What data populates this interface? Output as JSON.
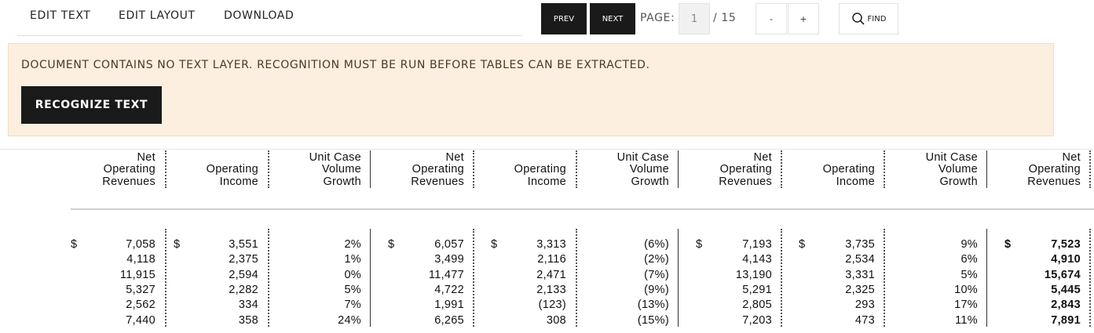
{
  "toolbar": {
    "menu": [
      "EDIT TEXT",
      "EDIT LAYOUT",
      "DOWNLOAD"
    ],
    "prev_label": "PREV",
    "next_label": "NEXT",
    "page_label": "PAGE:",
    "page_value": "1",
    "page_total": "/ 15",
    "zoom_out_label": "-",
    "zoom_in_label": "+",
    "find_label": "FIND",
    "find_icon": "search-icon"
  },
  "banner": {
    "message": "DOCUMENT CONTAINS NO TEXT LAYER. RECOGNITION MUST BE RUN BEFORE TABLES CAN BE EXTRACTED.",
    "button_label": "RECOGNIZE TEXT",
    "background": "#fcefdf"
  },
  "table": {
    "headers": [
      [
        "Net",
        "Operating",
        "Revenues"
      ],
      [
        "Operating",
        "Income"
      ],
      [
        "Unit Case",
        "Volume",
        "Growth"
      ],
      [
        "Net",
        "Operating",
        "Revenues"
      ],
      [
        "Operating",
        "Income"
      ],
      [
        "Unit Case",
        "Volume",
        "Growth"
      ],
      [
        "Net",
        "Operating",
        "Revenues"
      ],
      [
        "Operating",
        "Income"
      ],
      [
        "Unit Case",
        "Volume",
        "Growth"
      ],
      [
        "Net",
        "Operating",
        "Revenues"
      ]
    ],
    "currency_symbol": "$",
    "rows": [
      [
        "7,058",
        "3,551",
        "2%",
        "6,057",
        "3,313",
        "(6%)",
        "7,193",
        "3,735",
        "9%",
        "7,523"
      ],
      [
        "4,118",
        "2,375",
        "1%",
        "3,499",
        "2,116",
        "(2%)",
        "4,143",
        "2,534",
        "6%",
        "4,910"
      ],
      [
        "11,915",
        "2,594",
        "0%",
        "11,477",
        "2,471",
        "(7%)",
        "13,190",
        "3,331",
        "5%",
        "15,674"
      ],
      [
        "5,327",
        "2,282",
        "5%",
        "4,722",
        "2,133",
        "(9%)",
        "5,291",
        "2,325",
        "10%",
        "5,445"
      ],
      [
        "2,562",
        "334",
        "7%",
        "1,991",
        "(123)",
        "(13%)",
        "2,805",
        "293",
        "17%",
        "2,843"
      ],
      [
        "7,440",
        "358",
        "24%",
        "6,265",
        "308",
        "(15%)",
        "7,203",
        "473",
        "11%",
        "7,891"
      ]
    ]
  }
}
